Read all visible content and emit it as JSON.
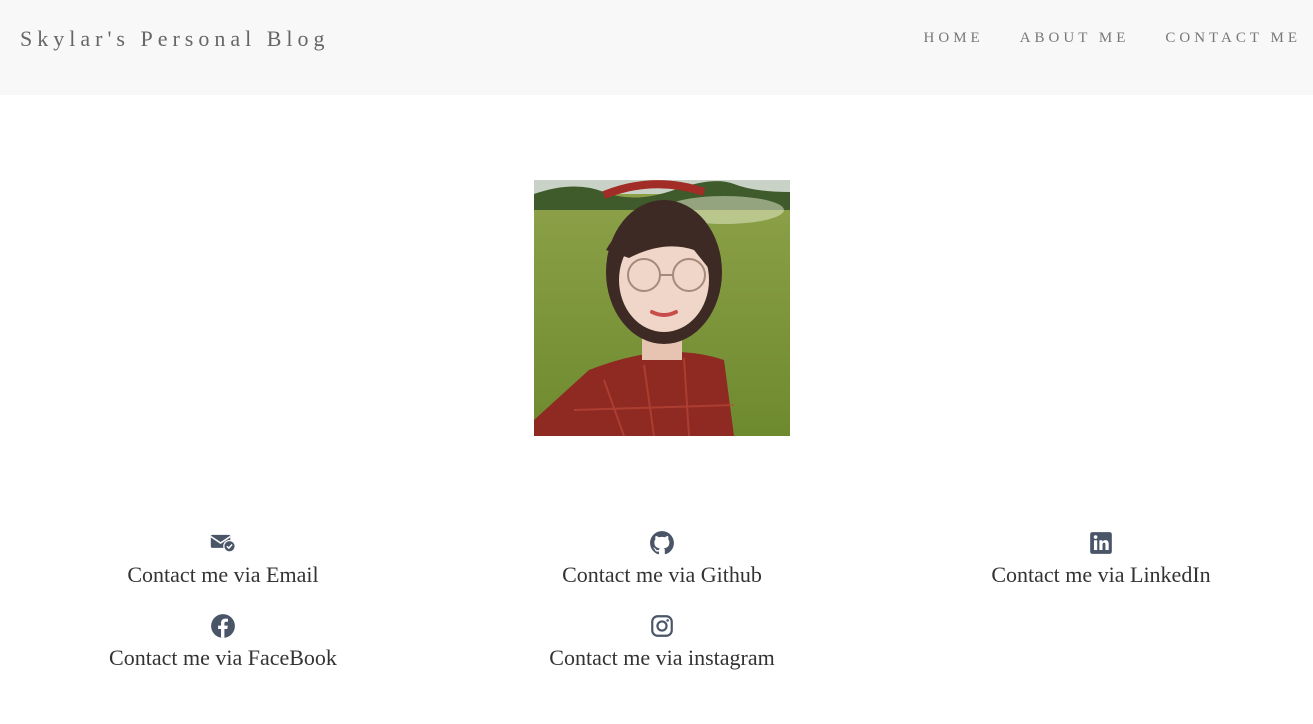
{
  "header": {
    "brand": "Skylar's Personal Blog",
    "nav": [
      {
        "label": "HOME"
      },
      {
        "label": "ABOUT ME"
      },
      {
        "label": "CONTACT ME"
      }
    ]
  },
  "contacts": [
    {
      "label": "Contact me via Email",
      "icon": "email-icon"
    },
    {
      "label": "Contact me via Github",
      "icon": "github-icon"
    },
    {
      "label": "Contact me via LinkedIn",
      "icon": "linkedin-icon"
    },
    {
      "label": "Contact me via FaceBook",
      "icon": "facebook-icon"
    },
    {
      "label": "Contact me via instagram",
      "icon": "instagram-icon"
    }
  ],
  "colors": {
    "navbar_bg": "#f8f8f8",
    "icon": "#4a5568",
    "text": "#333333"
  }
}
